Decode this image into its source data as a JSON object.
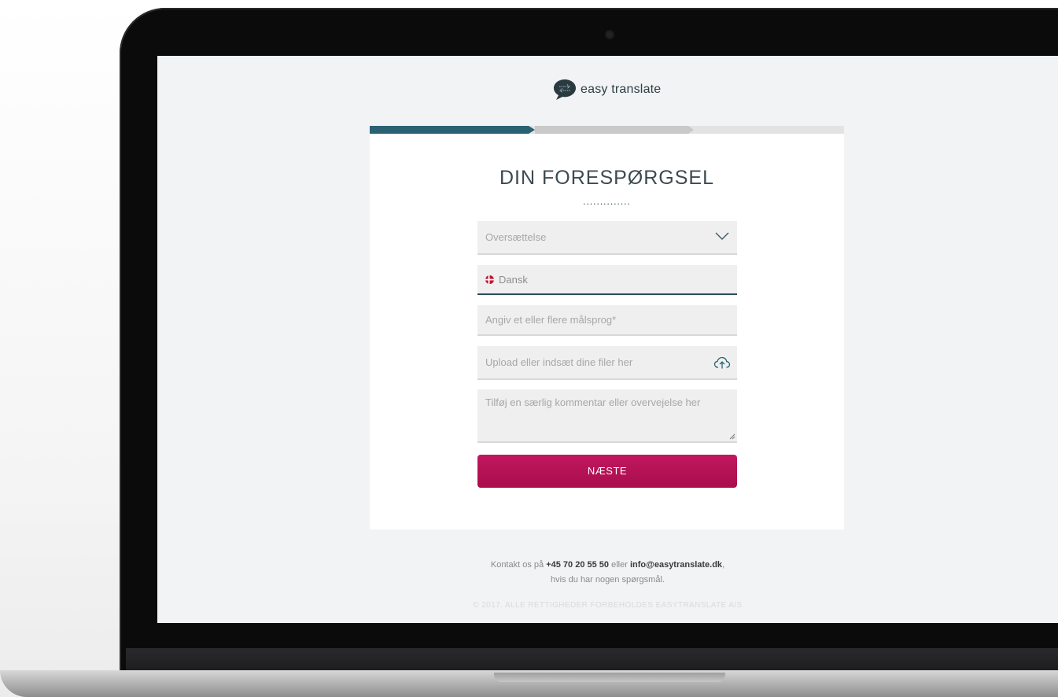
{
  "brand": {
    "name": "easy translate",
    "accent": "#2b6273",
    "cta_color": "#b5125a"
  },
  "progress": {
    "current_step": 1,
    "total_steps": 3
  },
  "form": {
    "title": "DIN FORESPØRGSEL",
    "divider": "..............",
    "service_select": {
      "value": "Oversættelse"
    },
    "source_language": {
      "value": "Dansk",
      "flag": "denmark-flag-icon"
    },
    "target_languages": {
      "placeholder": "Angiv et eller flere målsprog*"
    },
    "upload": {
      "placeholder": "Upload eller indsæt dine filer her",
      "icon": "cloud-upload-icon"
    },
    "comment": {
      "placeholder": "Tilføj en særlig kommentar eller overvejelse her"
    },
    "next_button": "NÆSTE"
  },
  "footer": {
    "contact_prefix": "Kontakt os på",
    "phone": "+45 70 20 55 50",
    "contact_middle": "eller",
    "email": "info@easytranslate.dk",
    "contact_suffix": ",",
    "contact_line2": "hvis du har nogen spørgsmål.",
    "copyright": "© 2017. ALLE RETTIGHEDER FORBEHOLDES EASYTRANSLATE A/S"
  }
}
